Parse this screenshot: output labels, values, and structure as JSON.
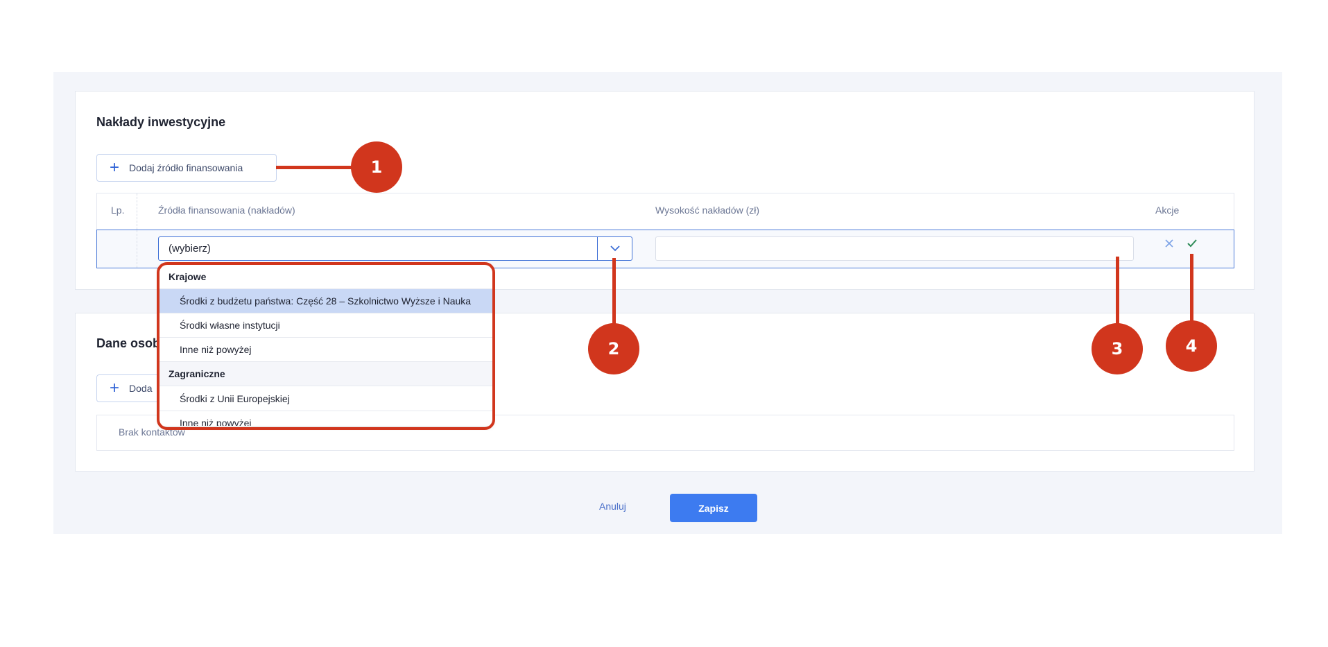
{
  "investments": {
    "title": "Nakłady inwestycyjne",
    "add_button_label": "Dodaj źródło finansowania",
    "table": {
      "headers": {
        "lp": "Lp.",
        "source": "Źródła finansowania (nakładów)",
        "amount": "Wysokość nakładów (zł)",
        "actions": "Akcje"
      },
      "edit_row": {
        "select_value": "(wybierz)",
        "amount_value": ""
      }
    },
    "dropdown": {
      "groups": [
        {
          "label": "Krajowe",
          "options": [
            "Środki z budżetu państwa: Część 28 – Szkolnictwo Wyższe i Nauka",
            "Środki własne instytucji",
            "Inne niż powyżej"
          ]
        },
        {
          "label": "Zagraniczne",
          "options": [
            "Środki z Unii Europejskiej",
            "Inne niż powyżej"
          ]
        }
      ],
      "highlighted_option": "Środki z budżetu państwa: Część 28 – Szkolnictwo Wyższe i Nauka"
    }
  },
  "contacts": {
    "title_partial": "Dane osob",
    "add_button_partial": "Doda",
    "empty_text": "Brak kontaktów"
  },
  "footer": {
    "cancel_label": "Anuluj",
    "save_label": "Zapisz"
  },
  "callouts": [
    "1",
    "2",
    "3",
    "4"
  ],
  "colors": {
    "accent": "#3d7bf0",
    "callout": "#d1361d",
    "confirm_icon": "#2e8b57",
    "cancel_icon": "#7da3e6"
  },
  "icons": {
    "add": "plus-icon",
    "select_arrow": "chevron-down-icon",
    "cancel_row": "close-icon",
    "confirm_row": "check-icon"
  }
}
